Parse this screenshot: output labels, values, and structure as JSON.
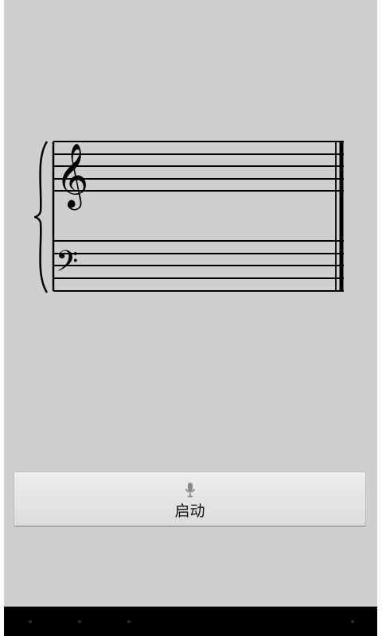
{
  "button": {
    "label": "启动",
    "icon": "microphone-icon"
  },
  "score": {
    "treble_clef": "𝄞",
    "bass_clef": "𝄢"
  },
  "colors": {
    "background": "#cfcfcf",
    "staff_ink": "#000000",
    "nav_bar": "#000000"
  }
}
